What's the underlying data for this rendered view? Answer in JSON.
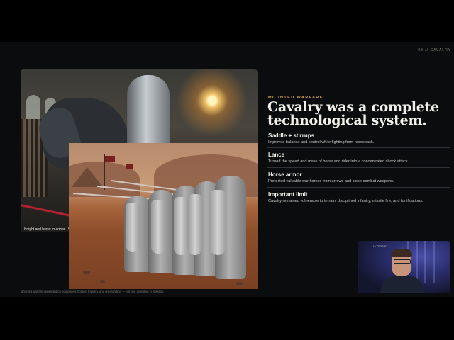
{
  "slide": {
    "label": "03 // CAVALRY",
    "eyebrow": "MOUNTED WARFARE",
    "headline": "Cavalry was a complete technological system.",
    "items": [
      {
        "title": "Saddle + stirrups",
        "desc": "Improved balance and control while fighting from horseback."
      },
      {
        "title": "Lance",
        "desc": "Turned the speed and mass of horse and rider into a concentrated shock attack."
      },
      {
        "title": "Horse armor",
        "desc": "Protected valuable war horses from arrows and close-combat weapons."
      },
      {
        "title": "Important limit",
        "desc": "Cavalry remained vulnerable to terrain, disciplined infantry, missile fire, and fortifications."
      }
    ],
    "image_caption": "Knight and horse in armor · Wikimedia",
    "footer_note": "Mounted warfare depended on equipment, horses, training, and organization — not one invention in isolation."
  },
  "webcam": {
    "logo_text": "HYPERCRIT"
  },
  "colors": {
    "accent": "#d9a24a",
    "slide_background": "#0a0c0d",
    "headline": "#f2f0ea"
  }
}
